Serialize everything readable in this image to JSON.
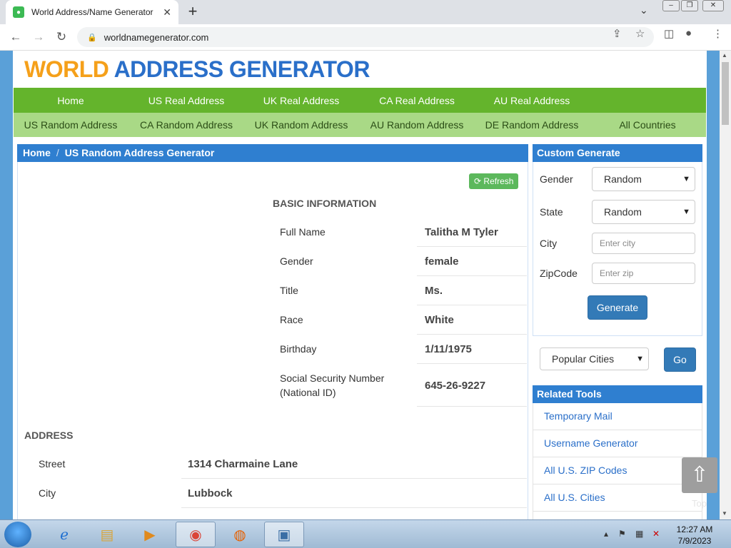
{
  "browser": {
    "tab_title": "World Address/Name Generator",
    "tab_close": "✕",
    "new_tab": "+",
    "url": "worldnamegenerator.com"
  },
  "logo": {
    "part1": "WORLD",
    "part2": "ADDRESS GENERATOR"
  },
  "nav_primary": [
    "Home",
    "US Real Address",
    "UK Real Address",
    "CA Real Address",
    "AU Real Address"
  ],
  "nav_secondary": [
    "US Random Address",
    "CA Random Address",
    "UK Random Address",
    "AU Random Address",
    "DE Random Address",
    "All Countries"
  ],
  "breadcrumb": {
    "home": "Home",
    "sep": "/",
    "current": "US Random Address Generator"
  },
  "refresh_label": "Refresh",
  "basic_info": {
    "title": "BASIC INFORMATION",
    "rows": [
      {
        "label": "Full Name",
        "value": "Talitha M Tyler"
      },
      {
        "label": "Gender",
        "value": "female"
      },
      {
        "label": "Title",
        "value": "Ms."
      },
      {
        "label": "Race",
        "value": "White"
      },
      {
        "label": "Birthday",
        "value": "1/11/1975"
      },
      {
        "label": "Social Security Number (National ID)",
        "value": "645-26-9227"
      }
    ]
  },
  "address": {
    "title": "ADDRESS",
    "rows": [
      {
        "label": "Street",
        "value": "1314 Charmaine Lane"
      },
      {
        "label": "City",
        "value": "Lubbock"
      }
    ]
  },
  "custom_generate": {
    "title": "Custom Generate",
    "gender_label": "Gender",
    "gender_value": "Random",
    "state_label": "State",
    "state_value": "Random",
    "city_label": "City",
    "city_placeholder": "Enter city",
    "zip_label": "ZipCode",
    "zip_placeholder": "Enter zip",
    "generate_label": "Generate",
    "popular_cities": "Popular Cities",
    "go_label": "Go"
  },
  "related_tools": {
    "title": "Related Tools",
    "items": [
      "Temporary Mail",
      "Username Generator",
      "All U.S. ZIP Codes",
      "All U.S. Cities"
    ]
  },
  "to_top_label": "Top",
  "clock": {
    "time": "12:27 AM",
    "date": "7/9/2023"
  },
  "colors": {
    "nav_green": "#64b42c",
    "nav_light_green": "#a9d986",
    "header_blue": "#2f7fd0",
    "logo_orange": "#f5a01a",
    "logo_blue": "#2a6fc9"
  }
}
